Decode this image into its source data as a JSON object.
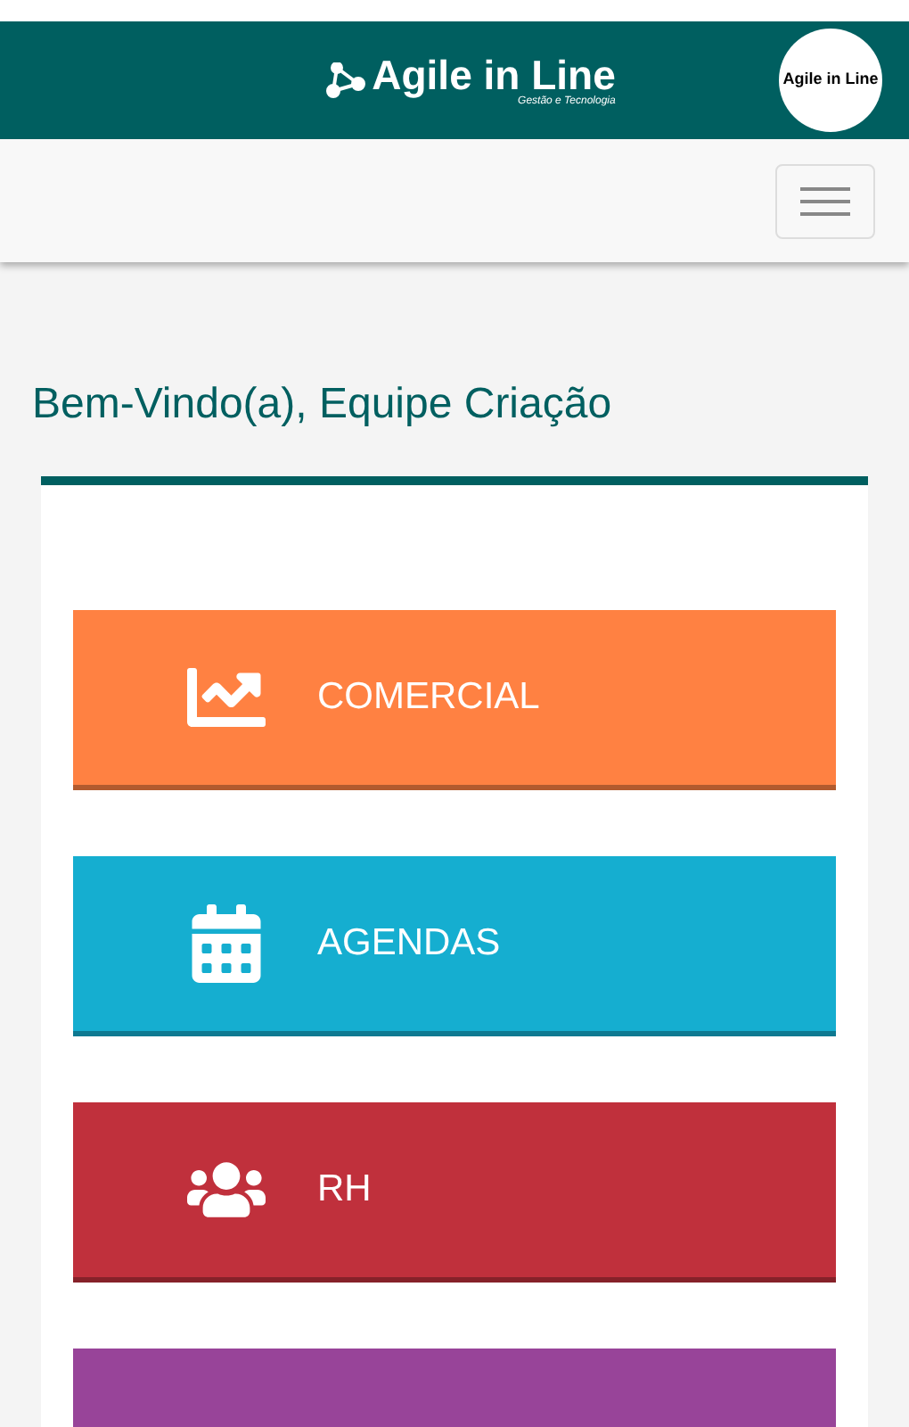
{
  "header": {
    "brand": "Agile in Line",
    "tagline": "Gestão e Tecnologia",
    "avatar_text": "Agile in Line"
  },
  "greeting": "Bem-Vindo(a), Equipe Criação",
  "tiles": [
    {
      "kind": "chart",
      "label": "COMERCIAL",
      "color": "#ff8142"
    },
    {
      "kind": "calendar",
      "label": "AGENDAS",
      "color": "#15aed0"
    },
    {
      "kind": "people",
      "label": "RH",
      "color": "#c0303c"
    },
    {
      "color": "#984499"
    }
  ]
}
